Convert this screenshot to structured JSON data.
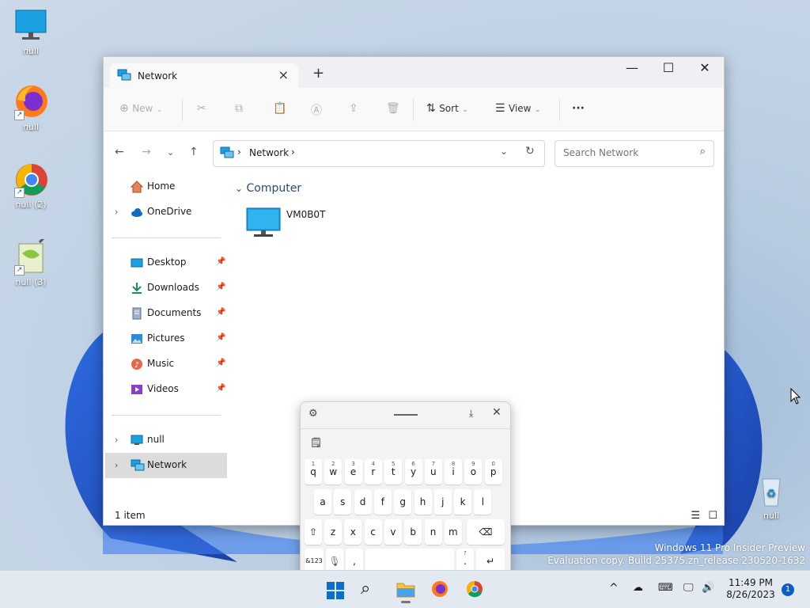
{
  "desktop": {
    "icons": [
      {
        "label": "null"
      },
      {
        "label": "null"
      },
      {
        "label": "null (2)"
      },
      {
        "label": "null (3)"
      }
    ],
    "recycle_bin": {
      "label": "null"
    },
    "watermark": {
      "line1": "Windows 11 Pro Insider Preview",
      "line2": "Evaluation copy. Build 25375.zn_release.230520-1632"
    }
  },
  "explorer": {
    "tab_title": "Network",
    "toolbar": {
      "new_label": "New",
      "sort_label": "Sort",
      "view_label": "View",
      "more_label": "···"
    },
    "address": {
      "segment": "Network"
    },
    "search": {
      "placeholder": "Search Network"
    },
    "sidebar": {
      "home": "Home",
      "onedrive": "OneDrive",
      "quick": [
        "Desktop",
        "Downloads",
        "Documents",
        "Pictures",
        "Music",
        "Videos"
      ],
      "null_item": "null",
      "network_item": "Network"
    },
    "content": {
      "group_label": "Computer",
      "item_name": "VM0B0T"
    },
    "status": "1 item"
  },
  "keyboard": {
    "row1": [
      {
        "k": "q",
        "n": "1"
      },
      {
        "k": "w",
        "n": "2"
      },
      {
        "k": "e",
        "n": "3"
      },
      {
        "k": "r",
        "n": "4"
      },
      {
        "k": "t",
        "n": "5"
      },
      {
        "k": "y",
        "n": "6"
      },
      {
        "k": "u",
        "n": "7"
      },
      {
        "k": "i",
        "n": "8"
      },
      {
        "k": "o",
        "n": "9"
      },
      {
        "k": "p",
        "n": "0"
      }
    ],
    "row2": [
      "a",
      "s",
      "d",
      "f",
      "g",
      "h",
      "j",
      "k",
      "l"
    ],
    "row3": [
      "z",
      "x",
      "c",
      "v",
      "b",
      "n",
      "m"
    ],
    "num_key": "&123",
    "comma": ",",
    "period": ".",
    "period_alt": "?"
  },
  "taskbar": {
    "time": "11:49 PM",
    "date": "8/26/2023",
    "notification_count": "1"
  }
}
